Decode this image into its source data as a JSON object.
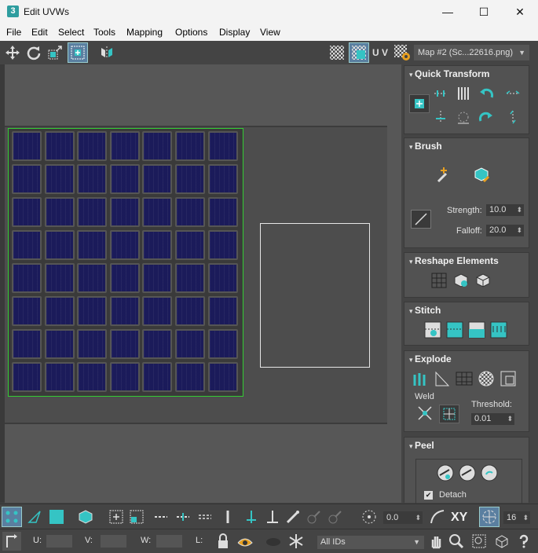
{
  "window": {
    "title": "Edit UVWs",
    "app_icon": "3",
    "minimize": "—",
    "maximize": "☐",
    "close": "✕"
  },
  "menu": [
    "File",
    "Edit",
    "Select",
    "Tools",
    "Mapping",
    "Options",
    "Display",
    "View"
  ],
  "toolbar": {
    "uv_label": "U V",
    "map_select": "Map #2 (Sc...22616.png)"
  },
  "rollouts": {
    "quick_transform": "Quick Transform",
    "brush": "Brush",
    "brush_strength_label": "Strength:",
    "brush_strength_value": "10.0",
    "brush_falloff_label": "Falloff:",
    "brush_falloff_value": "20.0",
    "reshape": "Reshape Elements",
    "stitch": "Stitch",
    "explode": "Explode",
    "weld_label": "Weld",
    "threshold_label": "Threshold:",
    "threshold_value": "0.01",
    "peel": "Peel",
    "detach_label": "Detach",
    "detach_checked": "✔"
  },
  "bottom": {
    "spinner_value": "0.0",
    "xy_label": "XY",
    "grid_value": "16",
    "u_label": "U:",
    "v_label": "V:",
    "w_label": "W:",
    "l_label": "L:",
    "ids_select": "All IDs"
  },
  "colors": {
    "accent": "#35c4c4",
    "uv_border": "#33cc33",
    "tile": "#1b1b5a"
  }
}
